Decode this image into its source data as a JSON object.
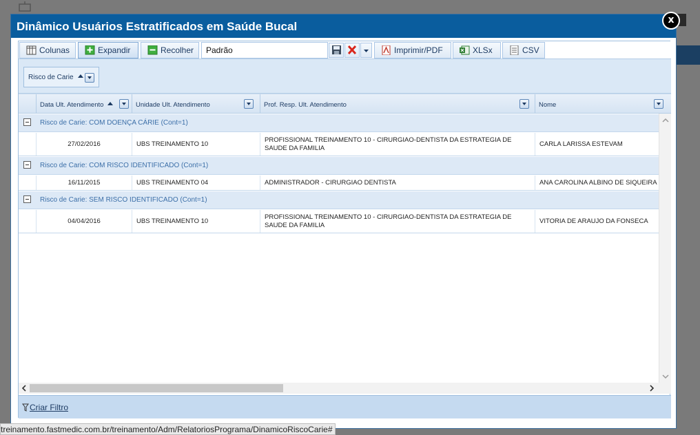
{
  "modal": {
    "title": "Dinâmico Usuários Estratificados em Saúde Bucal",
    "close_label": "x"
  },
  "toolbar": {
    "colunas": "Colunas",
    "expandir": "Expandir",
    "recolher": "Recolher",
    "layout_value": "Padrão",
    "pdf": "Imprimir/PDF",
    "xlsx": "XLSx",
    "csv": "CSV"
  },
  "group_area": {
    "chip_label": "Risco de Carie"
  },
  "grid": {
    "columns": [
      "Data Ult. Atendimento",
      "Unidade Ult. Atendimento",
      "Prof. Resp. Ult. Atendimento",
      "Nome"
    ],
    "groups": [
      {
        "label": "Risco de Carie: COM DOENÇA CÁRIE (Cont=1)",
        "row": {
          "data": "27/02/2016",
          "unidade": "UBS TREINAMENTO 10",
          "prof": "PROFISSIONAL TREINAMENTO 10 - CIRURGIAO-DENTISTA DA ESTRATEGIA DE SAUDE DA FAMILIA",
          "nome": "CARLA LARISSA ESTEVAM"
        }
      },
      {
        "label": "Risco de Carie: COM RISCO IDENTIFICADO (Cont=1)",
        "row": {
          "data": "16/11/2015",
          "unidade": "UBS TREINAMENTO 04",
          "prof": "ADMINISTRADOR - CIRURGIAO DENTISTA",
          "nome": "ANA CAROLINA ALBINO DE SIQUEIRA"
        }
      },
      {
        "label": "Risco de Carie: SEM RISCO IDENTIFICADO (Cont=1)",
        "row": {
          "data": "04/04/2016",
          "unidade": "UBS TREINAMENTO 10",
          "prof": "PROFISSIONAL TREINAMENTO 10 - CIRURGIAO-DENTISTA DA ESTRATEGIA DE SAUDE DA FAMILIA",
          "nome": "VITORIA DE ARAUJO DA FONSECA"
        }
      }
    ]
  },
  "footer": {
    "filter_link": "Criar Filtro"
  },
  "status_url": "treinamento.fastmedic.com.br/treinamento/Adm/RelatoriosPrograma/DinamicoRiscoCarie#",
  "icons": {
    "colunas": "columns-icon",
    "expandir": "expand-plus-icon",
    "recolher": "collapse-minus-icon",
    "save": "floppy-disk-icon",
    "delete": "red-x-icon",
    "pdf": "pdf-icon",
    "xlsx": "excel-icon",
    "csv": "csv-document-icon",
    "filter": "funnel-icon"
  },
  "colors": {
    "title_bar": "#0a5d9e",
    "group_row": "#dde9f6",
    "group_text": "#3c6fa8",
    "footer": "#c5daf0"
  }
}
